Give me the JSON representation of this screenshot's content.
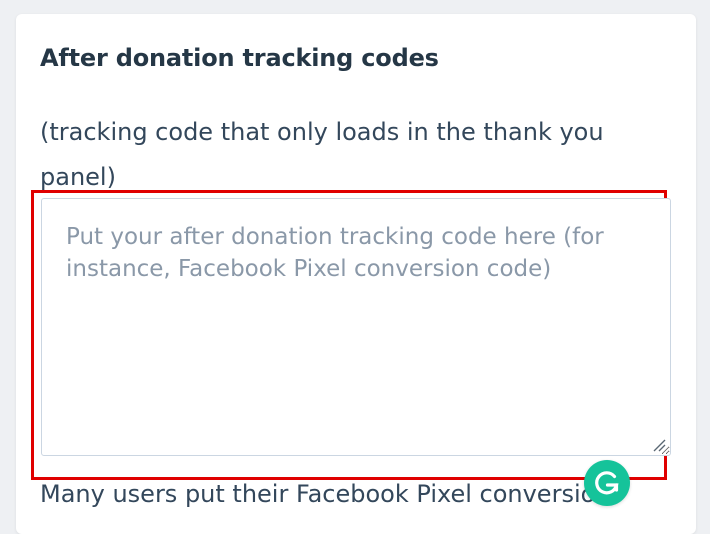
{
  "section": {
    "title": "After donation tracking codes",
    "help_text": "(tracking code that only loads in the thank you panel)"
  },
  "textarea": {
    "value": "",
    "placeholder": "Put your after donation tracking code here (for instance, Facebook Pixel conversion code)"
  },
  "footer": {
    "text": "Many users put their Facebook Pixel conversion"
  },
  "icons": {
    "resize_grip": "resize-grip-icon",
    "grammarly": "grammarly-icon"
  },
  "colors": {
    "highlight": "#e00000",
    "grammarly": "#15c39a",
    "title": "#253746",
    "text": "#33475b",
    "placeholder": "#8a98a8"
  }
}
